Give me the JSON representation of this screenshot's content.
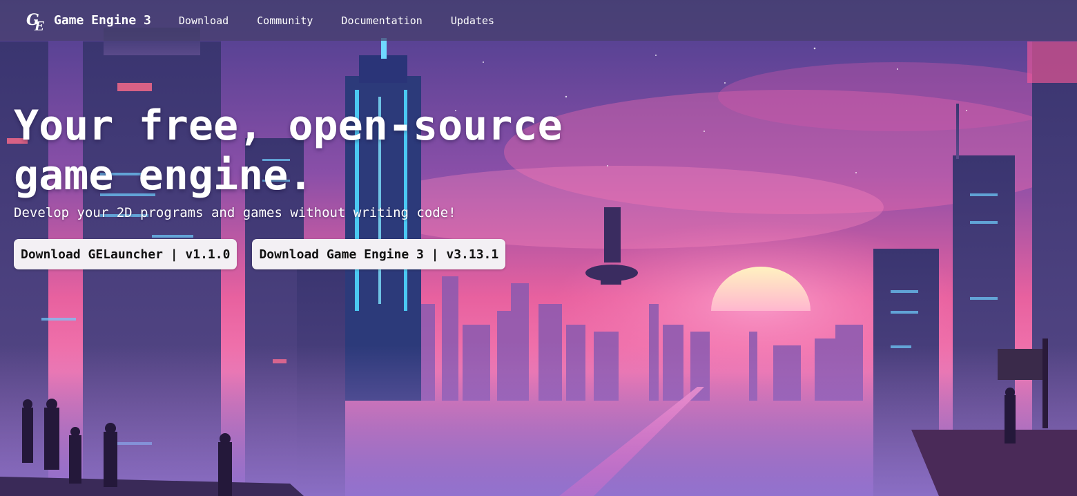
{
  "navbar": {
    "brand_logo_text": "GE",
    "brand_name": "Game Engine 3",
    "links": [
      {
        "label": "Download"
      },
      {
        "label": "Community"
      },
      {
        "label": "Documentation"
      },
      {
        "label": "Updates"
      }
    ]
  },
  "hero": {
    "title": "Your free, open-source game engine.",
    "subtitle": "Develop your 2D programs and games without writing code!",
    "buttons": [
      {
        "label": "Download GELauncher | v1.1.0"
      },
      {
        "label": "Download Game Engine 3 | v3.13.1"
      }
    ]
  },
  "colors": {
    "navbar_bg": "#46406c",
    "sky_top": "#3a3a8a",
    "sky_bottom": "#f06aa8",
    "sun": "#ffe9a8",
    "button_bg": "#f3f0f4",
    "text": "#ffffff"
  },
  "icons": {
    "brand_logo": "ge-logo-icon"
  }
}
